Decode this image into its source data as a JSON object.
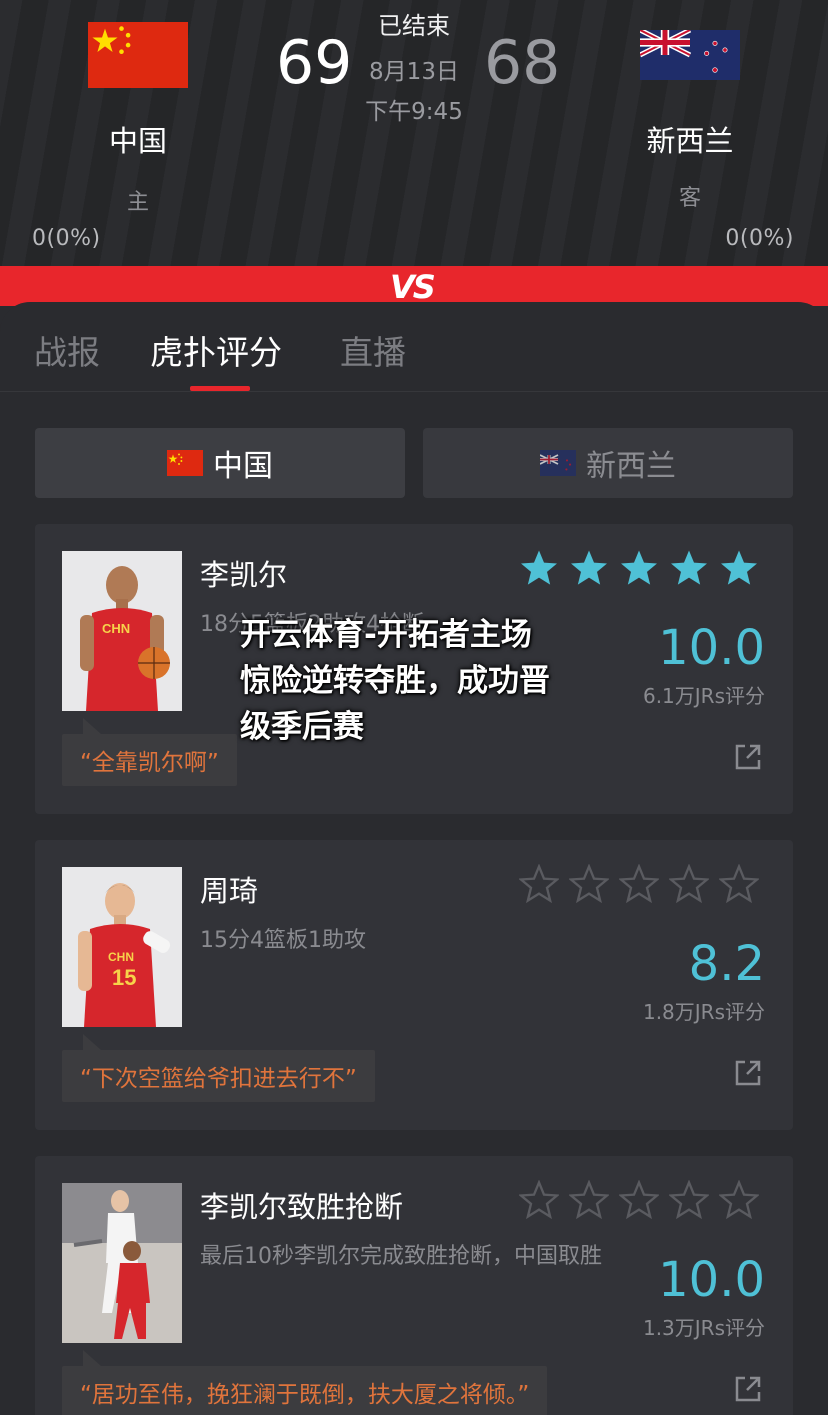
{
  "match": {
    "status": "已结束",
    "date": "8月13日",
    "time": "下午9:45",
    "home": {
      "name": "中国",
      "role": "主",
      "score": "69",
      "support": "0(0%)",
      "flag_icon": "china-flag-icon"
    },
    "away": {
      "name": "新西兰",
      "role": "客",
      "score": "68",
      "support": "0(0%)",
      "flag_icon": "new-zealand-flag-icon"
    },
    "vs_label": "VS"
  },
  "tabs": [
    {
      "label": "战报",
      "active": false
    },
    {
      "label": "虎扑评分",
      "active": true
    },
    {
      "label": "直播",
      "active": false
    }
  ],
  "team_switch": {
    "home_label": "中国",
    "away_label": "新西兰",
    "selected": "home"
  },
  "cards": [
    {
      "name": "李凯尔",
      "stats": "18分5篮板2助攻4抢断",
      "stars_filled": 5,
      "rating": "10.0",
      "votes": "6.1万JRs评分",
      "quote": "“全靠凯尔啊”"
    },
    {
      "name": "周琦",
      "stats": "15分4篮板1助攻",
      "stars_filled": 0,
      "rating": "8.2",
      "votes": "1.8万JRs评分",
      "quote": "“下次空篮给爷扣进去行不”"
    },
    {
      "name": "李凯尔致胜抢断",
      "stats": "最后10秒李凯尔完成致胜抢断，中国取胜",
      "stars_filled": 0,
      "rating": "10.0",
      "votes": "1.3万JRs评分",
      "quote": "“居功至伟，挽狂澜于既倒，扶大厦之将倾。”"
    }
  ],
  "overlay": {
    "line1": "开云体育-开拓者主场",
    "line2": "惊险逆转夺胜，成功晋",
    "line3": "级季后赛"
  },
  "colors": {
    "accent_red": "#e8262c",
    "rating_cyan": "#4fc1d6",
    "quote_orange": "#e0743c",
    "background": "#2a2b2f"
  }
}
